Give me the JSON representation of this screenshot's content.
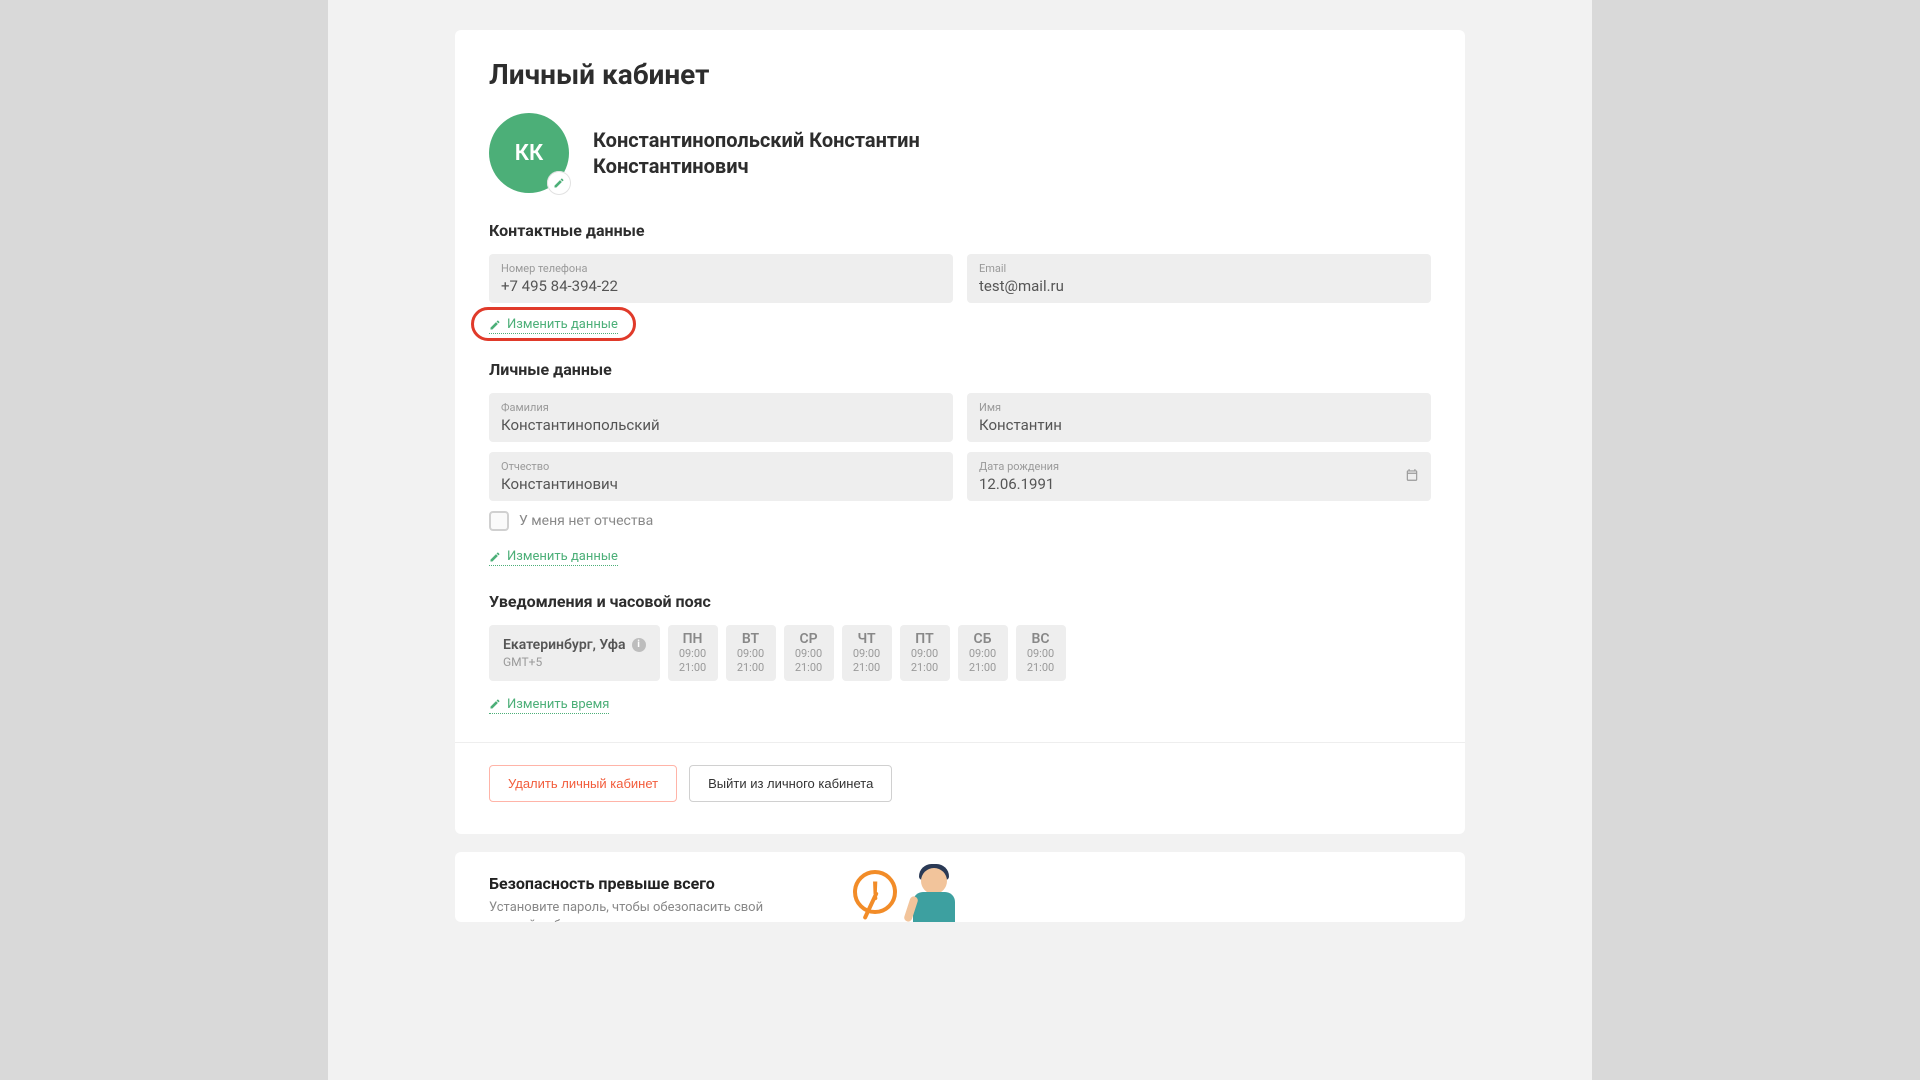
{
  "page_title": "Личный кабинет",
  "avatar_initials": "КК",
  "full_name_line1": "Константинопольский Константин",
  "full_name_line2": "Константинович",
  "contact": {
    "section_title": "Контактные данные",
    "phone_label": "Номер телефона",
    "phone_value": "+7 495 84-394-22",
    "email_label": "Email",
    "email_value": "test@mail.ru",
    "edit_label": "Изменить данные"
  },
  "personal": {
    "section_title": "Личные данные",
    "lastname_label": "Фамилия",
    "lastname_value": "Константинопольский",
    "firstname_label": "Имя",
    "firstname_value": "Константин",
    "middlename_label": "Отчество",
    "middlename_value": "Константинович",
    "birth_label": "Дата рождения",
    "birth_value": "12.06.1991",
    "no_middlename_label": "У меня нет отчества",
    "edit_label": "Изменить данные"
  },
  "notifications": {
    "section_title": "Уведомления и часовой пояс",
    "tz_city": "Екатеринбург, Уфа",
    "tz_offset": "GMT+5",
    "days": [
      {
        "label": "ПН",
        "from": "09:00",
        "to": "21:00"
      },
      {
        "label": "ВТ",
        "from": "09:00",
        "to": "21:00"
      },
      {
        "label": "СР",
        "from": "09:00",
        "to": "21:00"
      },
      {
        "label": "ЧТ",
        "from": "09:00",
        "to": "21:00"
      },
      {
        "label": "ПТ",
        "from": "09:00",
        "to": "21:00"
      },
      {
        "label": "СБ",
        "from": "09:00",
        "to": "21:00"
      },
      {
        "label": "ВС",
        "from": "09:00",
        "to": "21:00"
      }
    ],
    "edit_label": "Изменить время"
  },
  "footer": {
    "delete_label": "Удалить личный кабинет",
    "logout_label": "Выйти из личного кабинета"
  },
  "security": {
    "title": "Безопасность превыше всего",
    "subtitle": "Установите пароль, чтобы обезопасить свой личный кабинет"
  }
}
